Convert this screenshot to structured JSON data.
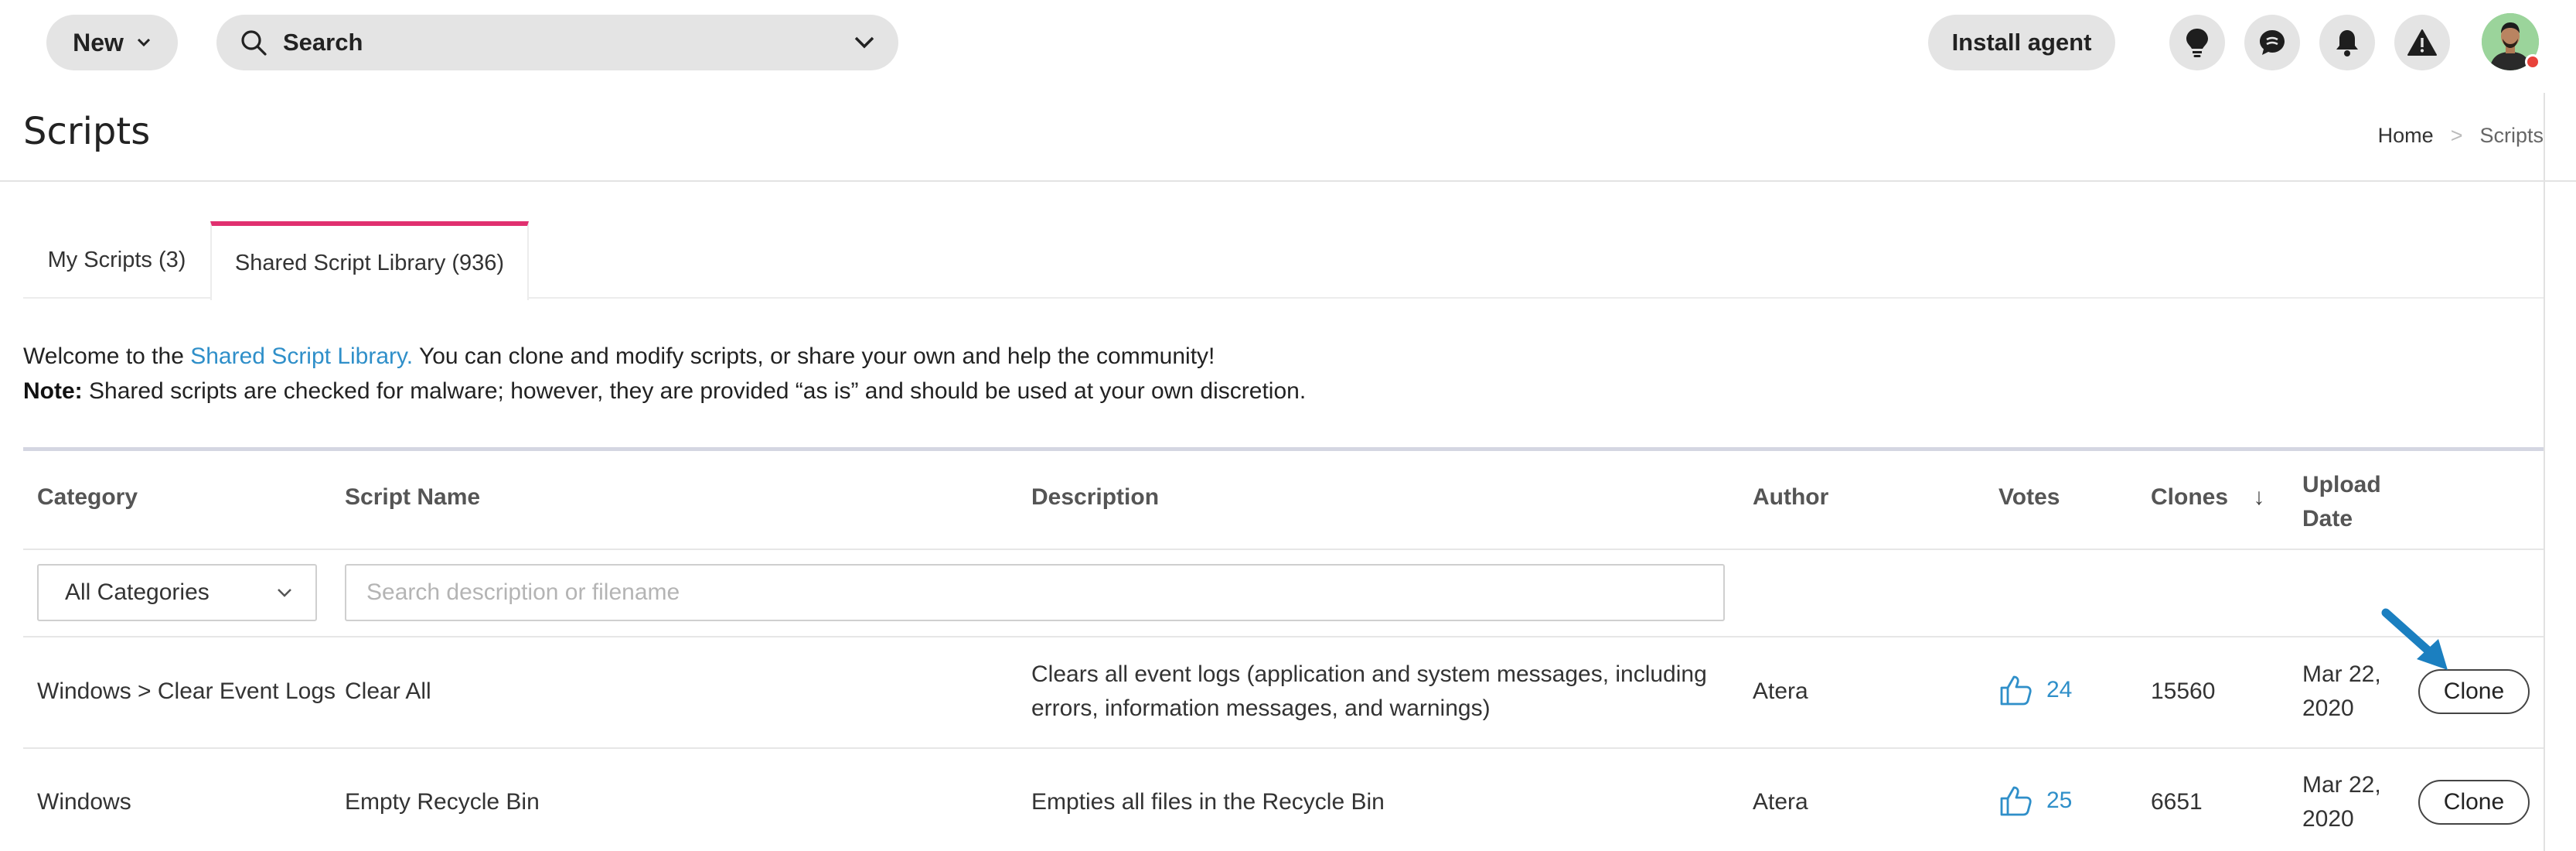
{
  "topbar": {
    "new_label": "New",
    "search_label": "Search",
    "install_label": "Install agent",
    "icons": [
      "lightbulb-icon",
      "chat-icon",
      "bell-icon",
      "warning-icon"
    ]
  },
  "header": {
    "title": "Scripts",
    "breadcrumb": {
      "home": "Home",
      "separator": ">",
      "current": "Scripts"
    }
  },
  "tabs": [
    {
      "label": "My Scripts (3)",
      "active": false
    },
    {
      "label": "Shared Script Library (936)",
      "active": true
    }
  ],
  "intro": {
    "welcome_prefix": "Welcome to the",
    "library_link": "Shared Script Library.",
    "welcome_suffix": "You can clone and modify scripts, or share your own and help the community!",
    "note_label": "Note:",
    "note_text": "Shared scripts are checked for malware; however, they are provided “as is” and should be used at your own discretion."
  },
  "table": {
    "headers": {
      "category": "Category",
      "script_name": "Script Name",
      "description": "Description",
      "author": "Author",
      "votes": "Votes",
      "clones": "Clones",
      "sort_indicator": "↓",
      "upload_line1": "Upload",
      "upload_line2": "Date"
    },
    "filters": {
      "category_selected": "All Categories",
      "search_placeholder": "Search description or filename"
    },
    "rows": [
      {
        "category": "Windows > Clear Event Logs",
        "name": "Clear All",
        "desc_line1": "Clears all event logs (application and system messages, including",
        "desc_line2": "errors, information messages, and warnings)",
        "author": "Atera",
        "votes": "24",
        "clones": "15560",
        "date_line1": "Mar 22,",
        "date_line2": "2020",
        "action": "Clone"
      },
      {
        "category": "Windows",
        "name": "Empty Recycle Bin",
        "desc_line1": "Empties all files in the Recycle Bin",
        "desc_line2": "",
        "author": "Atera",
        "votes": "25",
        "clones": "6651",
        "date_line1": "Mar 22,",
        "date_line2": "2020",
        "action": "Clone"
      }
    ]
  },
  "colors": {
    "accent_tab": "#e0306f",
    "link": "#2f8fc9",
    "pill": "#e4e4e4",
    "annotation_arrow": "#1b7fc0"
  }
}
